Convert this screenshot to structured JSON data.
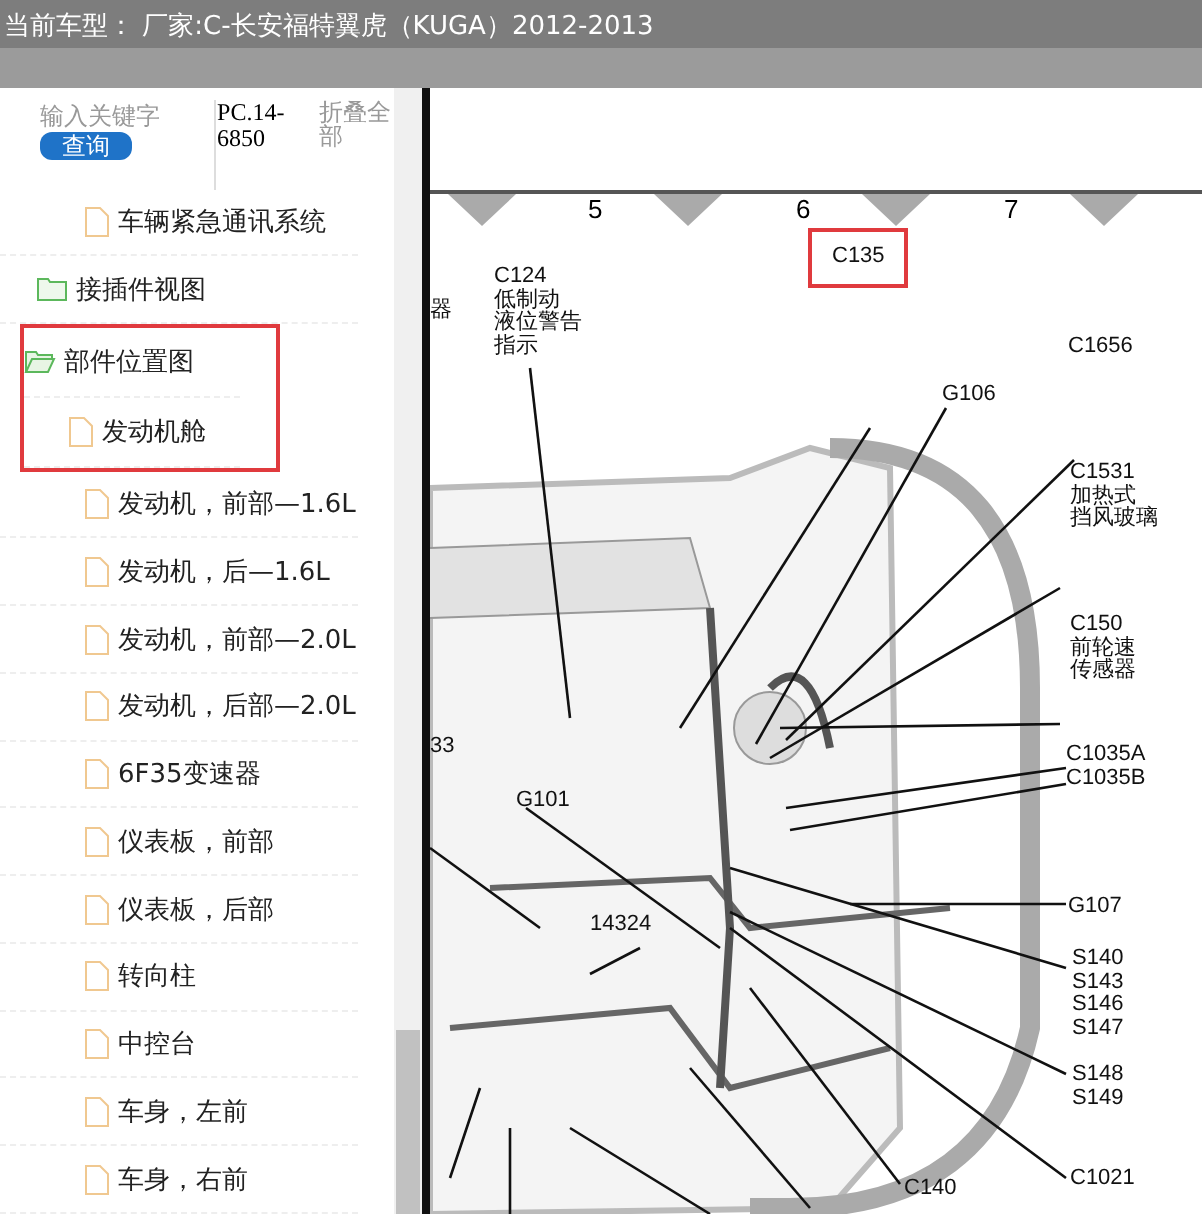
{
  "header": {
    "title": "当前车型： 厂家:C-长安福特翼虎（KUGA）2012-2013"
  },
  "search": {
    "placeholder": "输入关键字",
    "button": "查询",
    "code": "PC.14-6850",
    "collapse": "折叠全部"
  },
  "tree": [
    {
      "kind": "file",
      "label": "车辆紧急通讯系统",
      "indent": true
    },
    {
      "kind": "folder",
      "label": "接插件视图",
      "expanded": false,
      "highlighted": false
    },
    {
      "kind": "folder",
      "label": "部件位置图",
      "expanded": true,
      "highlighted": true,
      "children": [
        {
          "kind": "file",
          "label": "发动机舱"
        },
        {
          "kind": "file",
          "label": "发动机，前部—1.6L"
        },
        {
          "kind": "file",
          "label": "发动机，后—1.6L"
        },
        {
          "kind": "file",
          "label": "发动机，前部—2.0L"
        },
        {
          "kind": "file",
          "label": "发动机，后部—2.0L"
        },
        {
          "kind": "file",
          "label": "6F35变速器"
        },
        {
          "kind": "file",
          "label": "仪表板，前部"
        },
        {
          "kind": "file",
          "label": "仪表板，后部"
        },
        {
          "kind": "file",
          "label": "转向柱"
        },
        {
          "kind": "file",
          "label": "中控台"
        },
        {
          "kind": "file",
          "label": "车身，左前"
        },
        {
          "kind": "file",
          "label": "车身，右前"
        }
      ]
    }
  ],
  "diagram": {
    "columns": [
      "5",
      "6",
      "7"
    ],
    "labels": [
      {
        "kind": "marked",
        "text": "C135"
      },
      {
        "kind": "plain",
        "text": "器"
      },
      {
        "kind": "plain",
        "lines": [
          "C124",
          "低制动",
          "液位警告",
          "指示"
        ]
      },
      {
        "kind": "plain",
        "text": "C1656"
      },
      {
        "kind": "plain",
        "text": "G106"
      },
      {
        "kind": "plain",
        "lines": [
          "C1531",
          "加热式",
          "挡风玻璃"
        ]
      },
      {
        "kind": "plain",
        "lines": [
          "C150",
          "前轮速",
          "传感器"
        ]
      },
      {
        "kind": "plain",
        "text": "33"
      },
      {
        "kind": "plain",
        "lines": [
          "C1035A",
          "C1035B"
        ]
      },
      {
        "kind": "plain",
        "text": "G101"
      },
      {
        "kind": "plain",
        "text": "G107"
      },
      {
        "kind": "plain",
        "text": "14324"
      },
      {
        "kind": "plain",
        "lines": [
          "S140",
          "S143",
          "S146",
          "S147"
        ]
      },
      {
        "kind": "plain",
        "lines": [
          "S148",
          "S149"
        ]
      },
      {
        "kind": "plain",
        "text": "C140"
      },
      {
        "kind": "plain",
        "text": "C1021"
      }
    ]
  }
}
